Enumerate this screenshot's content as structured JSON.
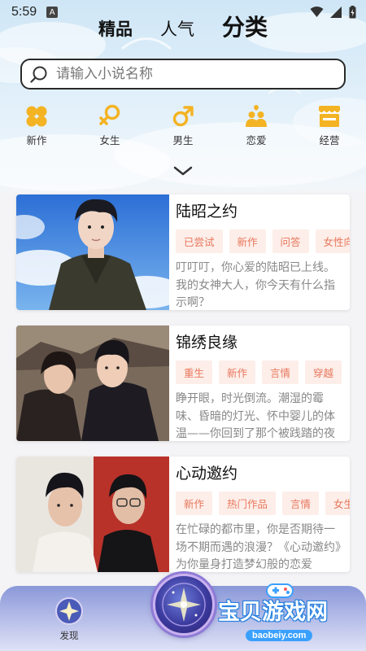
{
  "status": {
    "time": "5:59",
    "app_icon": "A"
  },
  "top_tabs": [
    {
      "label": "精品",
      "active": false
    },
    {
      "label": "人气",
      "active": false
    },
    {
      "label": "分类",
      "active": true
    }
  ],
  "search": {
    "placeholder": "请输入小说名称",
    "value": ""
  },
  "categories": [
    {
      "label": "新作",
      "icon": "clover-icon"
    },
    {
      "label": "女生",
      "icon": "female-icon"
    },
    {
      "label": "男生",
      "icon": "male-icon"
    },
    {
      "label": "恋爱",
      "icon": "couple-icon"
    },
    {
      "label": "经营",
      "icon": "shop-icon"
    }
  ],
  "books": [
    {
      "title": "陆昭之约",
      "tags": [
        "已尝试",
        "新作",
        "问答",
        "女性向"
      ],
      "desc": "叮叮叮，你心爱的陆昭已上线。我的女神大人，你今天有什么指示啊？"
    },
    {
      "title": "锦绣良缘",
      "tags": [
        "重生",
        "新作",
        "言情",
        "穿越"
      ],
      "desc": "睁开眼，时光倒流。潮湿的霉味、昏暗的灯光、怀中婴儿的体温——你回到了那个被践踏的夜晚"
    },
    {
      "title": "心动邀约",
      "tags": [
        "新作",
        "热门作品",
        "言情",
        "女生"
      ],
      "desc": "在忙碌的都市里，你是否期待一场不期而遇的浪漫？《心动邀约》为你量身打造梦幻般的恋爱"
    }
  ],
  "bottom_nav": {
    "discover_label": "发现"
  },
  "watermark": {
    "text": "宝贝游戏网",
    "sub": "baobeiy.com"
  },
  "colors": {
    "accent": "#f4b323",
    "tag_bg": "#fdeee9",
    "tag_text": "#e8775c",
    "nav": "#8a98d8"
  }
}
